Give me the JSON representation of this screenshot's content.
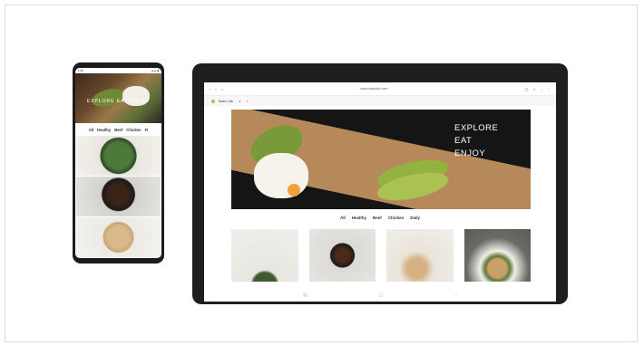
{
  "phone": {
    "status_left": "1:35",
    "status_right": "▲▲ ▮",
    "hero_text": "EXPLORE  EAT  ENJOY",
    "tabs": [
      "All",
      "Healthy",
      "Beef",
      "Chicken",
      "Fi"
    ]
  },
  "tablet": {
    "url": "www.website.com",
    "tab_label": "Taste Life",
    "hero_lines": [
      "EXPLORE",
      "EAT",
      "ENJOY"
    ],
    "tabs": [
      "All",
      "Healthy",
      "Beef",
      "Chicken",
      "Daily"
    ]
  }
}
